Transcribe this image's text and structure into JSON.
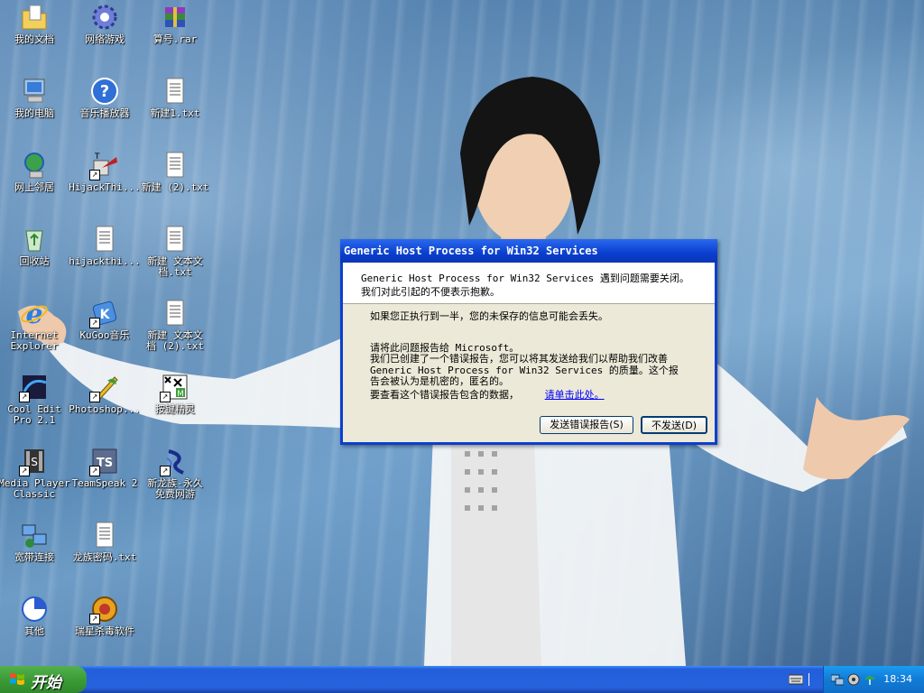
{
  "desktop_icons": [
    {
      "label": "我的文档",
      "icon": "my-documents-icon"
    },
    {
      "label": "网络游戏",
      "icon": "gear-icon"
    },
    {
      "label": "算号.rar",
      "icon": "rar-archive-icon"
    },
    {
      "label": "我的电脑",
      "icon": "my-computer-icon"
    },
    {
      "label": "音乐播放器",
      "icon": "help-icon"
    },
    {
      "label": "新建1.txt",
      "icon": "text-file-icon"
    },
    {
      "label": "网上邻居",
      "icon": "network-places-icon"
    },
    {
      "label": "HijackThi...",
      "icon": "hijackthis-icon"
    },
    {
      "label": "新建 (2).txt",
      "icon": "text-file-icon"
    },
    {
      "label": "回收站",
      "icon": "recycle-bin-icon"
    },
    {
      "label": "hijackthi...",
      "icon": "text-file-icon"
    },
    {
      "label": "新建 文本文\n档.txt",
      "icon": "text-file-icon"
    },
    {
      "label": "Internet\nExplorer",
      "icon": "internet-explorer-icon"
    },
    {
      "label": "KuGoo音乐",
      "icon": "kugoo-music-icon"
    },
    {
      "label": "新建 文本文\n档 (2).txt",
      "icon": "text-file-icon"
    },
    {
      "label": "Cool Edit\nPro 2.1",
      "icon": "cool-edit-icon"
    },
    {
      "label": "Photoshop...",
      "icon": "photoshop-icon"
    },
    {
      "label": "按键精灵",
      "icon": "key-wizard-icon"
    },
    {
      "label": "Media Player\nClassic",
      "icon": "media-player-icon"
    },
    {
      "label": "TeamSpeak 2",
      "icon": "teamspeak-icon"
    },
    {
      "label": "新龙族-永久\n免费网游",
      "icon": "dragon-game-icon"
    },
    {
      "label": "宽带连接",
      "icon": "broadband-icon"
    },
    {
      "label": "龙族密码.txt",
      "icon": "text-file-icon"
    },
    {
      "label": "其他",
      "icon": "pie-chart-icon"
    },
    {
      "label": "瑞星杀毒软件",
      "icon": "antivirus-icon"
    }
  ],
  "dialog": {
    "title": "Generic Host Process for Win32 Services",
    "header_text": "Generic Host Process for Win32 Services 遇到问题需要关闭。我们对此引起的不便表示抱歉。",
    "warning_text": "如果您正执行到一半，您的未保存的信息可能会丢失。",
    "report_line1": "请将此问题报告给 Microsoft。",
    "report_line2": "我们已创建了一个错误报告，您可以将其发送给我们以帮助我们改善 Generic Host Process for Win32 Services 的质量。这个报告会被认为是机密的，匿名的。",
    "data_prompt": "要查看这个错误报告包含的数据，",
    "data_link": "请单击此处。",
    "send_button": "发送错误报告(S)",
    "dont_send_button": "不发送(D)"
  },
  "taskbar": {
    "start_label": "开始",
    "clock": "18:34"
  },
  "colors": {
    "xp_blue": "#245edb",
    "title_blue": "#0a3fcf",
    "start_green": "#3c9c37",
    "dialog_bg": "#ece9d8"
  }
}
